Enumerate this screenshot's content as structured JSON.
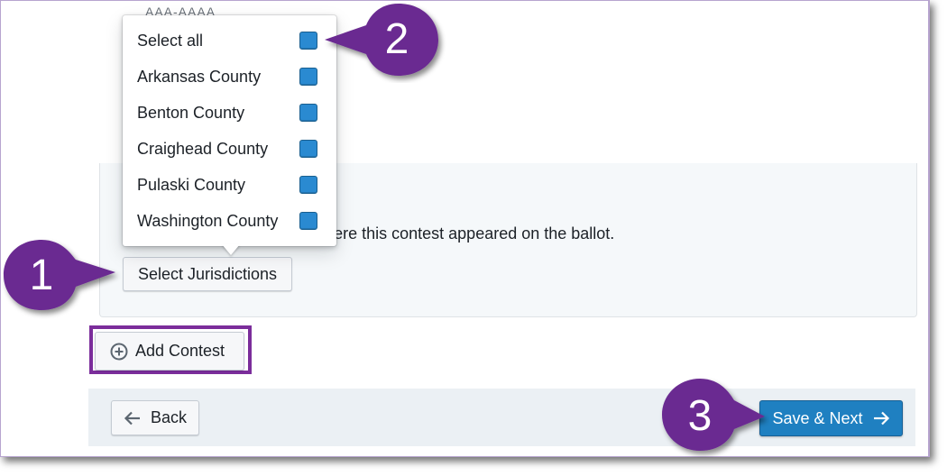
{
  "faded_header": "AAA-AAAA",
  "contest_panel": {
    "hint_text": "Select the jurisdictions where this contest appeared on the ballot."
  },
  "select_jurisdictions_button": {
    "label": "Select Jurisdictions"
  },
  "jurisdiction_menu": {
    "items": [
      {
        "label": "Select all",
        "checked": true
      },
      {
        "label": "Arkansas County",
        "checked": true
      },
      {
        "label": "Benton County",
        "checked": true
      },
      {
        "label": "Craighead County",
        "checked": true
      },
      {
        "label": "Pulaski County",
        "checked": true
      },
      {
        "label": "Washington County",
        "checked": true
      }
    ]
  },
  "add_contest_button": {
    "label": "Add Contest",
    "icon": "plus-circle-icon"
  },
  "footer": {
    "back_label": "Back",
    "back_icon": "arrow-left-icon",
    "next_label": "Save & Next",
    "next_icon": "arrow-right-icon"
  },
  "callouts": [
    {
      "number": "1"
    },
    {
      "number": "2"
    },
    {
      "number": "3"
    }
  ],
  "colors": {
    "callout_purple": "#6b2c91",
    "checkbox_blue": "#2a8ad1",
    "primary_button": "#1f80c1",
    "highlight_border": "#7b2d9b"
  }
}
